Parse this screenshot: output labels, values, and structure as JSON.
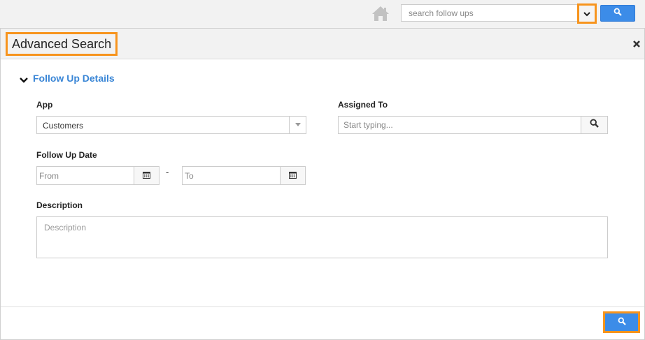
{
  "topbar": {
    "search_placeholder": "search follow ups",
    "icons": {
      "home": "home-icon",
      "dropdown": "chevron-down-icon",
      "search": "search-icon"
    }
  },
  "panel": {
    "title": "Advanced Search",
    "close_icon": "close-icon"
  },
  "section": {
    "title": "Follow Up Details",
    "toggle_icon": "chevron-down-icon"
  },
  "form": {
    "app": {
      "label": "App",
      "selected": "Customers"
    },
    "assigned_to": {
      "label": "Assigned To",
      "placeholder": "Start typing..."
    },
    "follow_up_date": {
      "label": "Follow Up Date",
      "from_placeholder": "From",
      "separator": "-",
      "to_placeholder": "To"
    },
    "description": {
      "label": "Description",
      "placeholder": "Description"
    }
  },
  "colors": {
    "accent": "#3c8ce8",
    "highlight": "#f7941d",
    "section_title": "#3a86d6"
  }
}
